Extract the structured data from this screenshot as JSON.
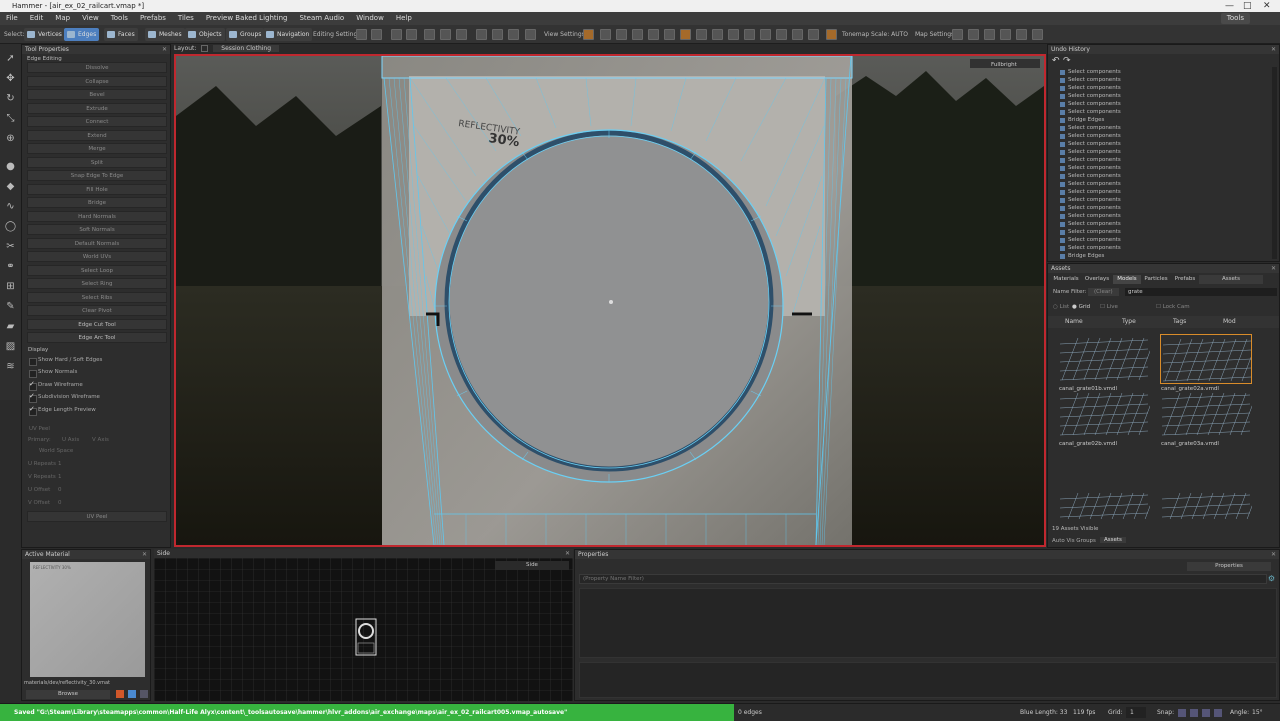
{
  "window": {
    "title": "Hammer - [air_ex_02_railcart.vmap *]",
    "min": "—",
    "max": "□",
    "close": "✕"
  },
  "menu": [
    "File",
    "Edit",
    "Map",
    "View",
    "Tools",
    "Prefabs",
    "Tiles",
    "Preview Baked Lighting",
    "Steam Audio",
    "Window",
    "Help"
  ],
  "menu_tools": "Tools",
  "toolbar": {
    "select_label": "Select:",
    "vertices": "Vertices",
    "edges": "Edges",
    "faces": "Faces",
    "meshes": "Meshes",
    "objects": "Objects",
    "groups": "Groups",
    "navigation": "Navigation",
    "editing_settings": "Editing Settings:",
    "view_settings": "View Settings:",
    "tonemap": "Tonemap Scale: AUTO",
    "map_settings": "Map Settings:"
  },
  "tool_properties": {
    "title": "Tool Properties",
    "section": "Edge Editing",
    "buttons": [
      "Dissolve",
      "Collapse",
      "Bevel",
      "Extrude",
      "Connect",
      "Extend",
      "Merge",
      "Split",
      "Snap Edge To Edge",
      "Fill Hole",
      "Bridge",
      "Hard Normals",
      "Soft Normals",
      "Default Normals",
      "World UVs",
      "Select Loop",
      "Select Ring",
      "Select Ribs",
      "Clear Pivot",
      "Edge Cut Tool",
      "Edge Arc Tool"
    ],
    "display_label": "Display",
    "checks": [
      {
        "label": "Show Hard / Soft Edges",
        "checked": false
      },
      {
        "label": "Show Normals",
        "checked": false
      },
      {
        "label": "Draw Wireframe",
        "checked": true
      },
      {
        "label": "Subdivision Wireframe",
        "checked": true
      },
      {
        "label": "Edge Length Preview",
        "checked": true
      }
    ],
    "uv_peel": "UV Peel",
    "primary": "Primary:",
    "u_axis": "U Axis",
    "v_axis": "V Axis",
    "world_space": "World Space",
    "u_repeats": "U Repeats",
    "u_repeats_val": "1",
    "v_repeats": "V Repeats",
    "v_repeats_val": "1",
    "u_offset": "U Offset",
    "u_offset_val": "0",
    "v_offset": "V Offset",
    "v_offset_val": "0",
    "uv_peel_btn": "UV Peel"
  },
  "layout": {
    "label": "Layout:",
    "session": "Session Clothing"
  },
  "viewport": {
    "mode": "Fullbright",
    "reflect_text": "REFLECTIVITY",
    "reflect_pct": "30%"
  },
  "undo": {
    "title": "Undo History",
    "items": [
      "Select components",
      "Select components",
      "Select components",
      "Select components",
      "Select components",
      "Select components",
      "Bridge Edges",
      "Select components",
      "Select components",
      "Select components",
      "Select components",
      "Select components",
      "Select components",
      "Select components",
      "Select components",
      "Select components",
      "Select components",
      "Select components",
      "Select components",
      "Select components",
      "Select components",
      "Select components",
      "Select components",
      "Bridge Edges"
    ]
  },
  "assets": {
    "title": "Assets",
    "tabs": [
      "Materials",
      "Overlays",
      "Models",
      "Particles",
      "Prefabs"
    ],
    "active_tab": "Models",
    "asset_dropdown": "Assets",
    "name_filter": "Name Filter:",
    "clear": "(Clear)",
    "filter_value": "grate",
    "list": "List",
    "grid": "Grid",
    "live": "Live",
    "lock_cam": "Lock Cam",
    "cols": [
      "Name",
      "Type",
      "Tags",
      "Mod"
    ],
    "items": [
      "canal_grate01b.vmdl",
      "canal_grate02a.vmdl",
      "canal_grate02b.vmdl",
      "canal_grate03a.vmdl",
      "",
      ""
    ],
    "visible": "19 Assets Visible",
    "bottom_tabs": [
      "Auto Vis Groups",
      "Assets"
    ]
  },
  "active_material": {
    "title": "Active Material",
    "thumb_text": "REFLECTIVITY 30%",
    "path": "materials/dev/reflectivity_30.vmat",
    "browse": "Browse"
  },
  "side_view": {
    "title": "Side",
    "dropdown": "Side"
  },
  "properties": {
    "title": "Properties",
    "dropdown": "Properties",
    "filter_placeholder": "(Property Name Filter)"
  },
  "status": {
    "saved": "Saved \"G:\\Steam\\Library\\steamapps\\common\\Half-Life Alyx\\content\\_toolsautosave\\hammer\\hlvr_addons\\air_exchange\\maps\\air_ex_02_railcart005.vmap_autosave\"",
    "edges": "0 edges",
    "blue_length": "Blue Length: 33",
    "fps": "119 fps",
    "grid": "Grid:",
    "grid_val": "1",
    "snap": "Snap:",
    "angle": "Angle:",
    "angle_val": "15°"
  }
}
